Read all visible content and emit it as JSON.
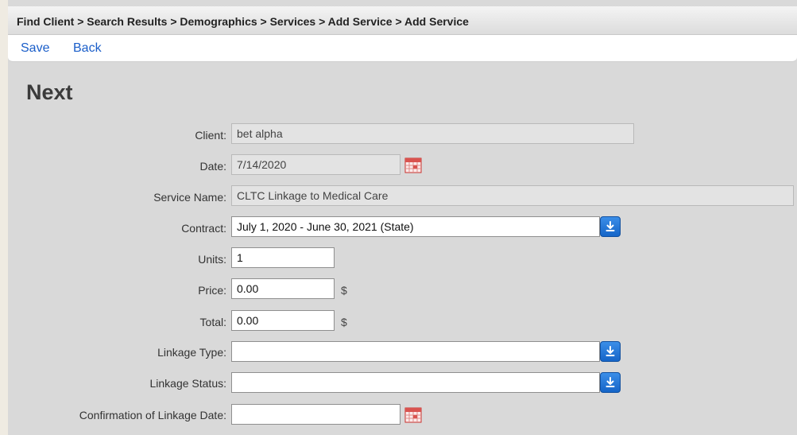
{
  "breadcrumb": "Find Client > Search Results > Demographics > Services > Add Service > Add Service",
  "toolbar": {
    "save_label": "Save",
    "back_label": "Back"
  },
  "page_title": "Next",
  "form": {
    "client": {
      "label": "Client:",
      "value": "bet alpha"
    },
    "date": {
      "label": "Date:",
      "value": "7/14/2020"
    },
    "service_name": {
      "label": "Service Name:",
      "value": "CLTC Linkage to Medical Care"
    },
    "contract": {
      "label": "Contract:",
      "value": "July 1, 2020 - June 30, 2021 (State)"
    },
    "units": {
      "label": "Units:",
      "value": "1"
    },
    "price": {
      "label": "Price:",
      "value": "0.00",
      "unit": "$"
    },
    "total": {
      "label": "Total:",
      "value": "0.00",
      "unit": "$"
    },
    "linkage_type": {
      "label": "Linkage Type:",
      "value": ""
    },
    "linkage_status": {
      "label": "Linkage Status:",
      "value": ""
    },
    "confirmation_date": {
      "label": "Confirmation of Linkage Date:",
      "value": ""
    }
  },
  "icons": {
    "dropdown": "download-arrow-icon",
    "calendar": "calendar-icon"
  },
  "colors": {
    "link": "#1a5ec9",
    "dropdown_button": "#1565c8",
    "calendar_accent": "#d9534f"
  }
}
